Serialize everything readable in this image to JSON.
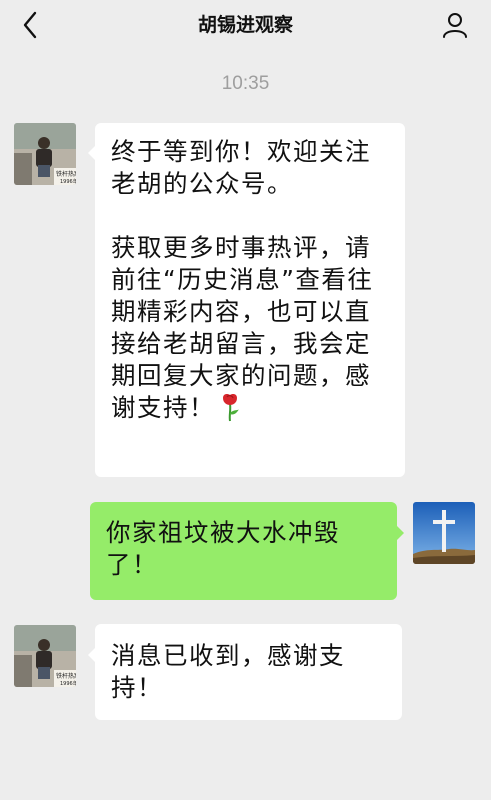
{
  "header": {
    "title": "胡锡进观察"
  },
  "chat": {
    "timestamp": "10:35",
    "messages": [
      {
        "sender": "official-account",
        "paragraphs": [
          "终于等到你！欢迎关注老胡的公众号。",
          "获取更多时事热评，请前往“历史消息”查看往期精彩内容，也可以直接给老胡留言，我会定期回复大家的问题，感谢支持！"
        ],
        "emoji": "rose-icon"
      },
      {
        "sender": "me",
        "text": "你家祖坟被大水冲毁了！"
      },
      {
        "sender": "official-account",
        "text": "消息已收到，感谢支持！"
      }
    ],
    "avatar_left_caption": "铁杆热窝 1996年"
  },
  "colors": {
    "background": "#ededed",
    "incoming_bubble": "#ffffff",
    "outgoing_bubble": "#95ec69",
    "timestamp": "#9e9e9e"
  }
}
